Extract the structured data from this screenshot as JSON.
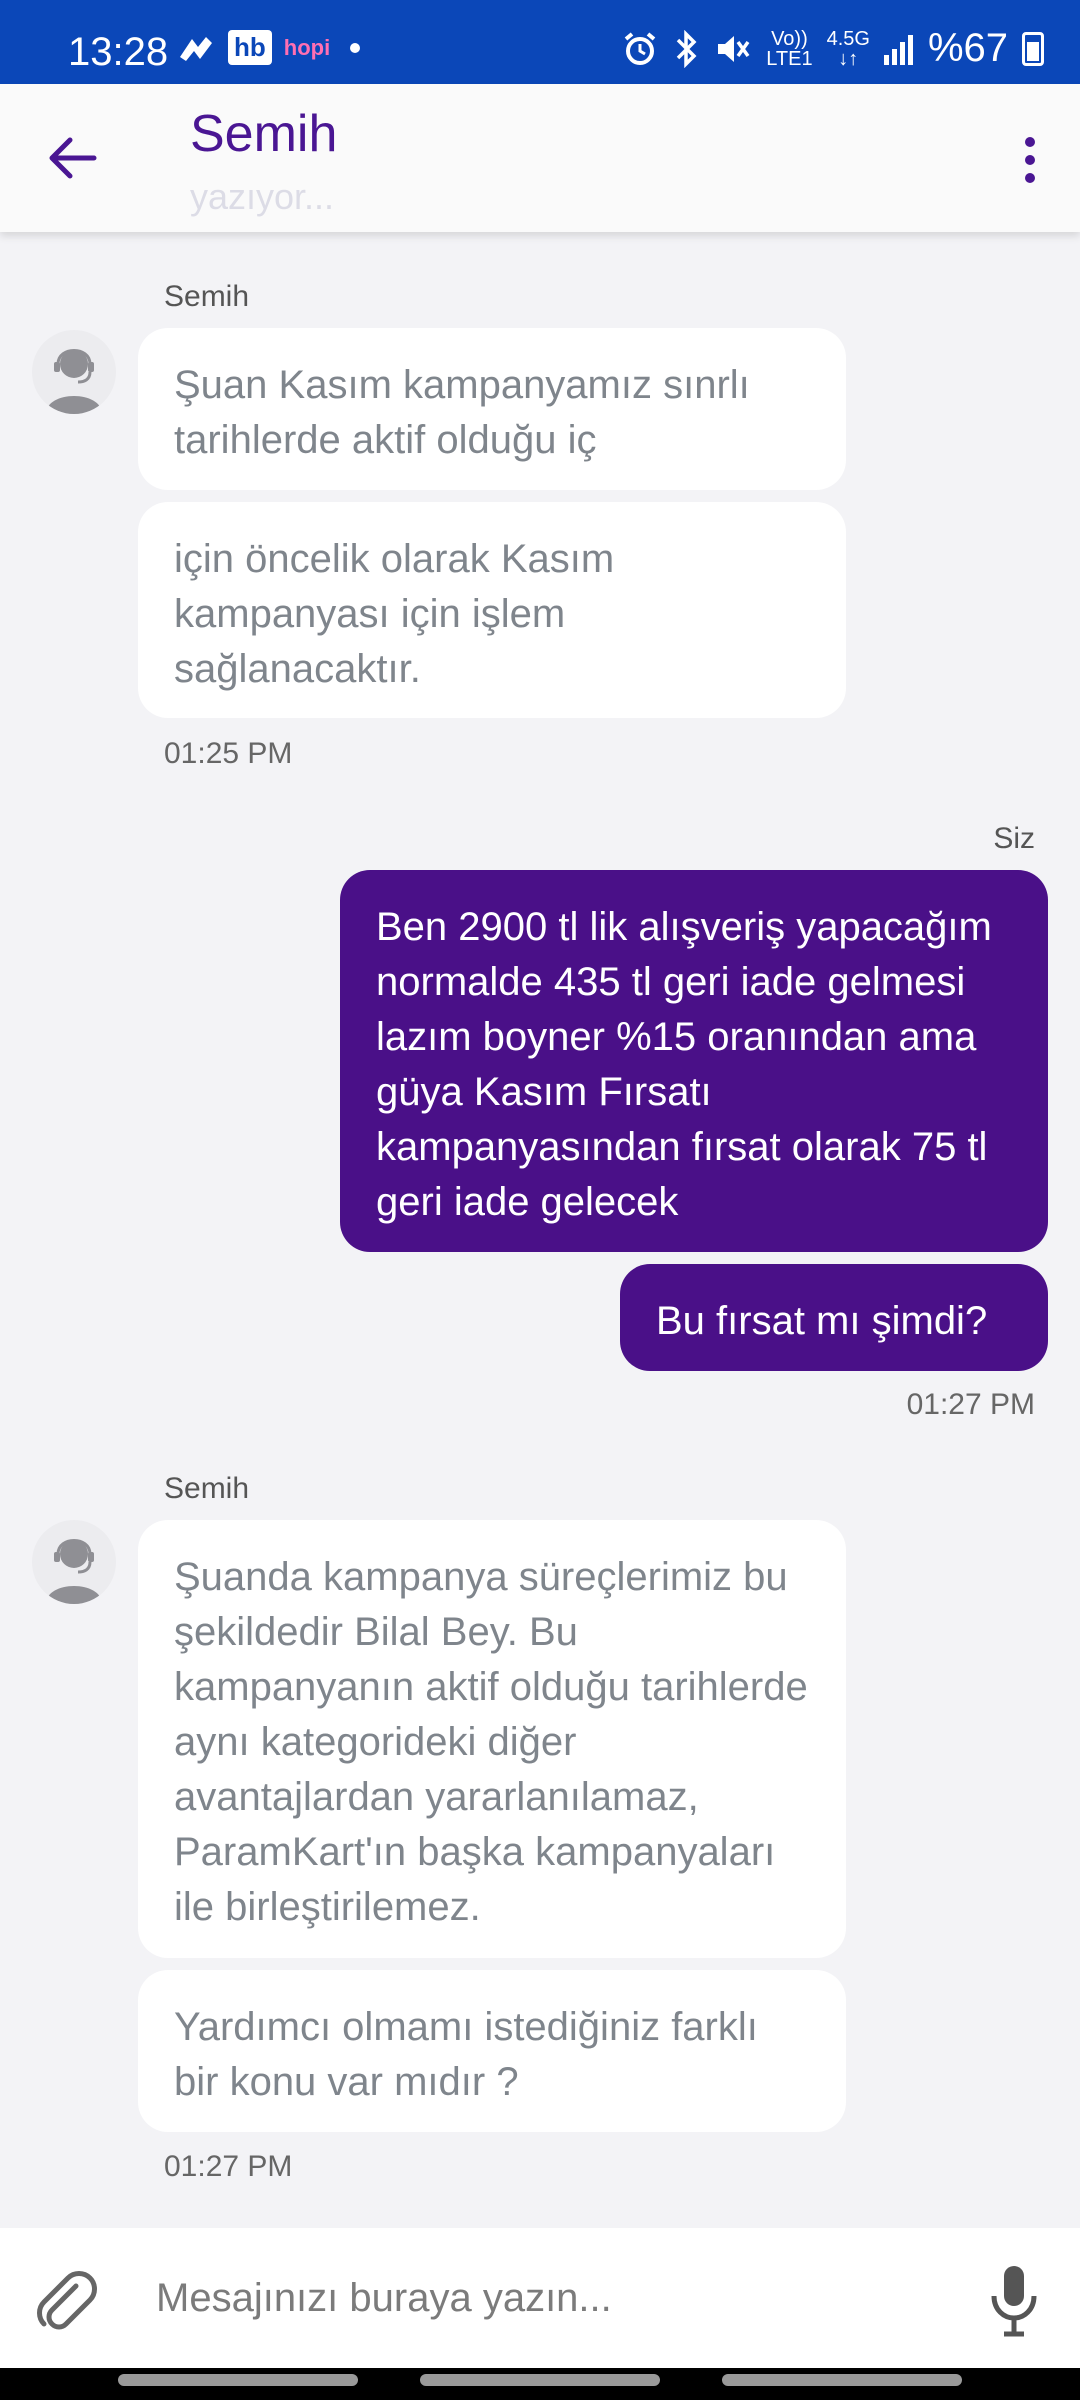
{
  "status_bar": {
    "time": "13:28",
    "hb": "hb",
    "hopi": "hopi",
    "network_top": "Vo))",
    "network_bottom": "LTE1",
    "signal_type": "4.5G",
    "battery": "%67"
  },
  "header": {
    "title": "Semih",
    "subtitle": "yazıyor..."
  },
  "messages": {
    "group1": {
      "sender": "Semih",
      "bubble1": "Şuan Kasım kampanyamız sınrlı tarihlerde aktif olduğu iç",
      "bubble2": "için öncelik olarak Kasım kampanyası için işlem sağlanacaktır.",
      "time": "01:25 PM"
    },
    "group2": {
      "sender": "Siz",
      "bubble1": "Ben 2900 tl lik alışveriş yapacağım normalde 435 tl geri iade gelmesi lazım boyner %15 oranından ama güya Kasım Fırsatı kampanyasından fırsat olarak 75 tl geri iade gelecek",
      "bubble2": "Bu fırsat mı şimdi?",
      "time": "01:27 PM"
    },
    "group3": {
      "sender": "Semih",
      "bubble1": "Şuanda kampanya süreçlerimiz bu şekildedir Bilal Bey. Bu kampanyanın aktif olduğu tarihlerde aynı kategorideki diğer avantajlardan yararlanılamaz, ParamKart'ın başka kampanyaları ile birleştirilemez.",
      "bubble2": "Yardımcı olmamı istediğiniz farklı bir konu var mıdır ?",
      "time": "01:27 PM"
    }
  },
  "composer": {
    "placeholder": "Mesajınızı buraya yazın..."
  },
  "colors": {
    "status_bar": "#0b47b8",
    "accent": "#4a1088",
    "incoming_text": "#7f858c"
  }
}
